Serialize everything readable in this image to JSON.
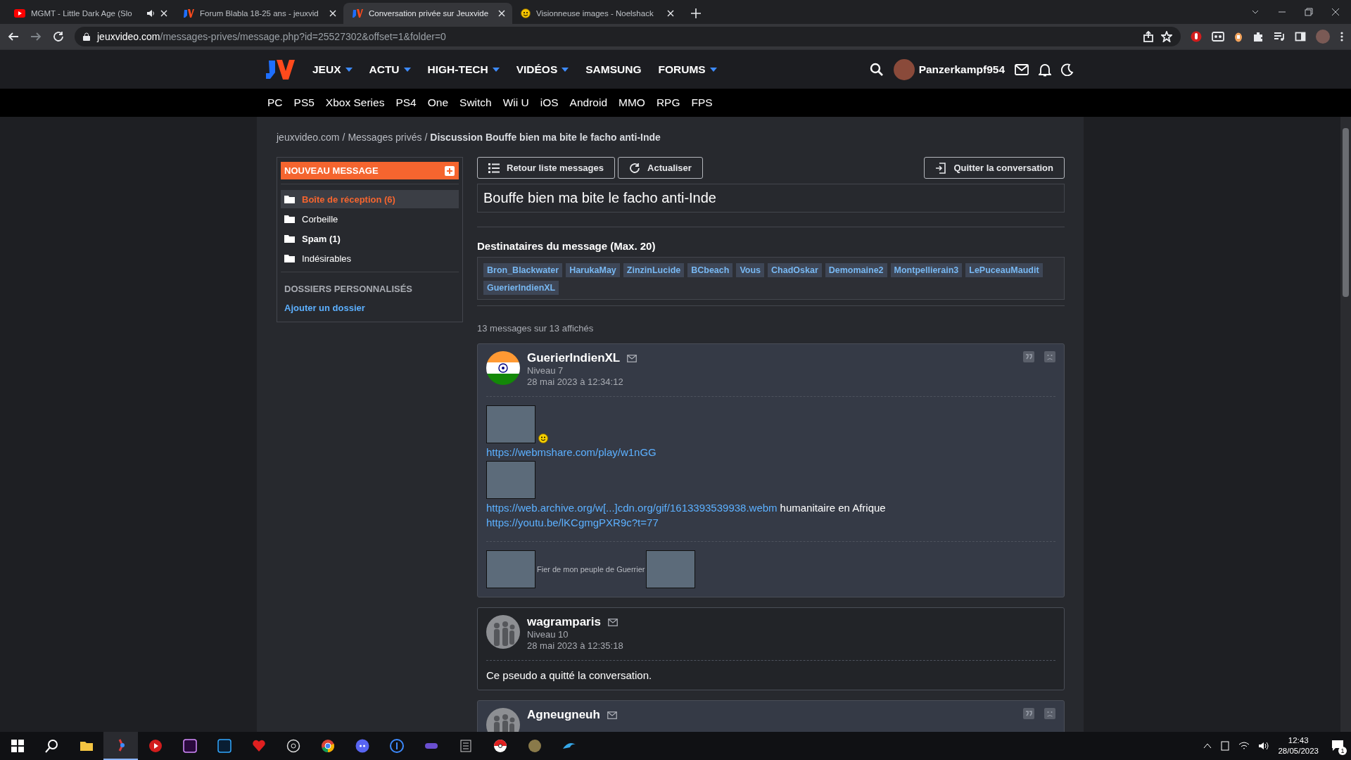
{
  "browser": {
    "tabs": [
      {
        "title": "MGMT - Little Dark Age (Slo",
        "kind": "youtube",
        "audio": true,
        "selected": false
      },
      {
        "title": "Forum Blabla 18-25 ans - jeuxvid",
        "kind": "jv",
        "audio": false,
        "selected": false
      },
      {
        "title": "Conversation privée sur Jeuxvide",
        "kind": "jv",
        "audio": false,
        "selected": true
      },
      {
        "title": "Visionneuse images - Noelshack",
        "kind": "noelshack",
        "audio": false,
        "selected": false
      }
    ],
    "url_host": "jeuxvideo.com",
    "url_path": "/messages-prives/message.php?id=25527302&offset=1&folder=0"
  },
  "header": {
    "menu": [
      {
        "label": "JEUX",
        "dropdown": true
      },
      {
        "label": "ACTU",
        "dropdown": true
      },
      {
        "label": "HIGH-TECH",
        "dropdown": true
      },
      {
        "label": "VIDÉOS",
        "dropdown": true
      },
      {
        "label": "SAMSUNG",
        "dropdown": false
      },
      {
        "label": "FORUMS",
        "dropdown": true
      }
    ],
    "username": "Panzerkampf954",
    "platforms": [
      "PC",
      "PS5",
      "Xbox Series",
      "PS4",
      "One",
      "Switch",
      "Wii U",
      "iOS",
      "Android",
      "MMO",
      "RPG",
      "FPS"
    ]
  },
  "breadcrumb": [
    {
      "kind": "link",
      "text": "jeuxvideo.com"
    },
    {
      "kind": "separator",
      "text": "/"
    },
    {
      "kind": "link",
      "text": "Messages privés"
    },
    {
      "kind": "separator",
      "text": "/"
    },
    {
      "kind": "current",
      "text": "Discussion Bouffe bien ma bite le facho anti-Inde"
    }
  ],
  "sidebar": {
    "new_message": "NOUVEAU MESSAGE",
    "folders": [
      {
        "label": "Boîte de réception (6)",
        "selected": true,
        "bold": true
      },
      {
        "label": "Corbeille",
        "selected": false,
        "bold": false
      },
      {
        "label": "Spam (1)",
        "selected": false,
        "bold": true
      },
      {
        "label": "Indésirables",
        "selected": false,
        "bold": false
      }
    ],
    "custom_heading": "DOSSIERS PERSONNALISÉS",
    "add_folder": "Ajouter un dossier"
  },
  "toolbar": {
    "back": "Retour liste messages",
    "refresh": "Actualiser",
    "leave": "Quitter la conversation"
  },
  "subject": "Bouffe bien ma bite le facho anti-Inde",
  "recipients": {
    "heading": "Destinataires du message (Max. 20)",
    "names": [
      "Bron_Blackwater",
      "HarukaMay",
      "ZinzinLucide",
      "BCbeach",
      "Vous",
      "ChadOskar",
      "Demomaine2",
      "Montpellierain3",
      "LePuceauMaudit",
      "GuerierIndienXL"
    ]
  },
  "count": "13 messages sur 13 affichés",
  "messages": [
    {
      "author": "GuerierIndienXL",
      "kind": "flag",
      "highlighted": true,
      "level": "Niveau 7",
      "date": "28 mai 2023 à 12:34:12",
      "body": [
        [
          {
            "kind": "image"
          },
          {
            "kind": "emoji"
          }
        ],
        [
          {
            "kind": "link",
            "text": "https://webmshare.com/play/w1nGG"
          }
        ],
        [
          {
            "kind": "image"
          }
        ],
        [
          {
            "kind": "link",
            "text": "https://web.archive.org/w[...]cdn.org/gif/1613393539938.webm"
          },
          {
            "kind": "text",
            "text": "humanitaire en Afrique"
          }
        ],
        [
          {
            "kind": "link",
            "text": "https://youtu.be/lKCgmgPXR9c?t=77"
          }
        ]
      ],
      "signature": [
        {
          "kind": "image"
        },
        {
          "kind": "caption",
          "text": "Fier de mon peuple de Guerrier"
        },
        {
          "kind": "image"
        }
      ]
    },
    {
      "author": "wagramparis",
      "kind": "photo",
      "highlighted": false,
      "level": "Niveau 10",
      "date": "28 mai 2023 à 12:35:18",
      "body": [
        [
          {
            "kind": "text",
            "text": "Ce pseudo a quitté la conversation."
          }
        ]
      ]
    },
    {
      "author": "Agneugneuh",
      "kind": "photo",
      "highlighted": true
    }
  ],
  "clock": {
    "time": "12:43",
    "date": "28/05/2023",
    "notifications": "1"
  }
}
